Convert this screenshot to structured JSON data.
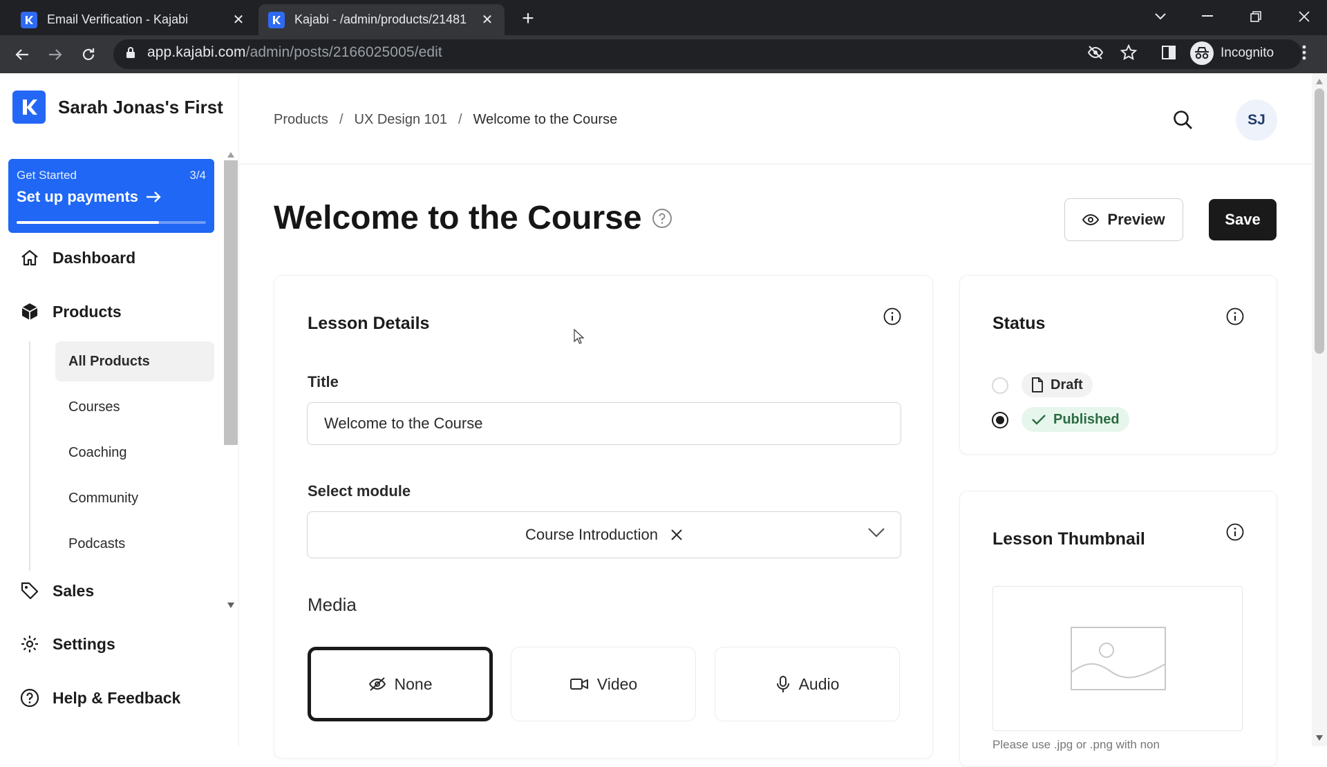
{
  "browser": {
    "tabs": [
      {
        "title": "Email Verification - Kajabi",
        "active": false
      },
      {
        "title": "Kajabi - /admin/products/21481",
        "active": true
      }
    ],
    "url_host": "app.kajabi.com",
    "url_path": "/admin/posts/2166025005/edit",
    "profile_label": "Incognito"
  },
  "sidebar": {
    "site_name": "Sarah Jonas's First",
    "get_started": {
      "label": "Get Started",
      "count": "3/4",
      "action": "Set up payments",
      "progress": 0.75
    },
    "nav": {
      "dashboard": "Dashboard",
      "products": "Products",
      "sales": "Sales",
      "settings": "Settings",
      "help": "Help & Feedback"
    },
    "product_items": [
      "All Products",
      "Courses",
      "Coaching",
      "Community",
      "Podcasts"
    ],
    "active_item": "All Products"
  },
  "header": {
    "breadcrumbs": [
      "Products",
      "UX Design 101",
      "Welcome to the Course"
    ],
    "breadcrumb_sep": "/",
    "avatar_initials": "SJ"
  },
  "page": {
    "title": "Welcome to the Course",
    "preview_label": "Preview",
    "save_label": "Save"
  },
  "lesson_details": {
    "heading": "Lesson Details",
    "title_label": "Title",
    "title_value": "Welcome to the Course",
    "module_label": "Select module",
    "module_value": "Course Introduction",
    "media_label": "Media",
    "media_options": [
      "None",
      "Video",
      "Audio"
    ],
    "media_selected": "None"
  },
  "status": {
    "heading": "Status",
    "options": [
      "Draft",
      "Published"
    ],
    "selected": "Published"
  },
  "thumbnail": {
    "heading": "Lesson Thumbnail",
    "hint": "Please use .jpg or .png with non"
  },
  "colors": {
    "brand": "#2467f5",
    "dark": "#1a1a1a",
    "published_bg": "#e7f6ec",
    "published_text": "#2b6b43"
  }
}
